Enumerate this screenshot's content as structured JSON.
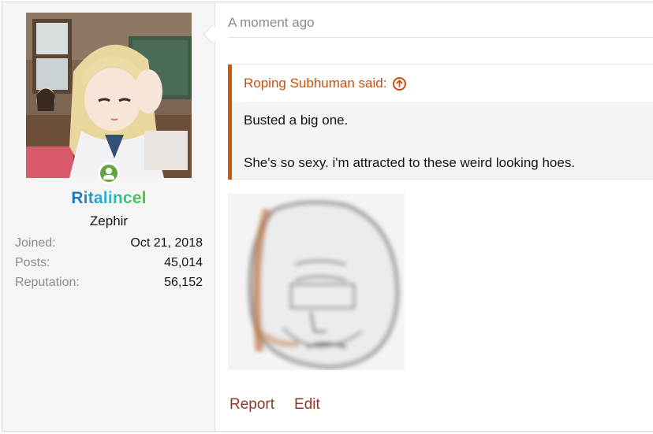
{
  "post": {
    "timestamp": "A moment ago"
  },
  "user": {
    "name": "Ritalincel",
    "title": "Zephir",
    "stats": [
      {
        "label": "Joined:",
        "value": "Oct 21, 2018"
      },
      {
        "label": "Posts:",
        "value": "45,014"
      },
      {
        "label": "Reputation:",
        "value": "56,152"
      }
    ],
    "status_icon": "online-user-icon"
  },
  "quote": {
    "author": "Roping Subhuman said:",
    "expand_icon": "arrow-up-circle-icon",
    "lines": [
      "Busted a big one.",
      "She's so sexy. i'm attracted to these weird looking hoes."
    ]
  },
  "actions": {
    "report": "Report",
    "edit": "Edit"
  },
  "colors": {
    "quote_accent": "#cc5a0e",
    "link": "#8b3a2b",
    "status": "#62a73e"
  }
}
